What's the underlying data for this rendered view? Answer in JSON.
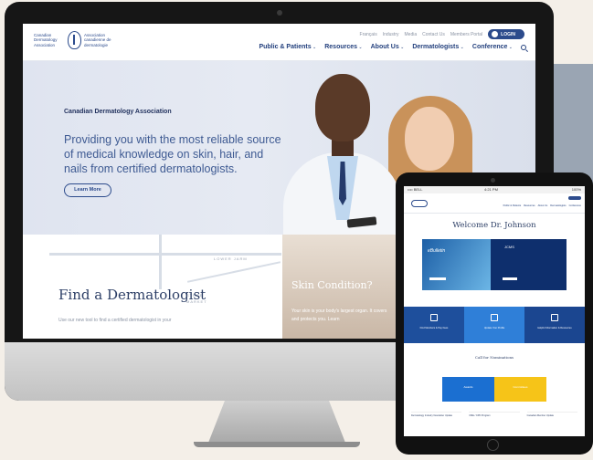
{
  "imac_site": {
    "logo": {
      "en": "Canadian Dermatology Association",
      "fr": "Association canadienne de dermatologie"
    },
    "utility_links": [
      "Français",
      "Industry",
      "Media",
      "Contact Us",
      "Members Portal"
    ],
    "login_label": "LOGIN",
    "nav": [
      "Public & Patients",
      "Resources",
      "About Us",
      "Dermatologists",
      "Conference"
    ],
    "hero": {
      "kicker": "Canadian Dermatology Association",
      "headline": "Providing you with the most reliable source of medical knowledge on skin, hair, and nails from certified dermatologists.",
      "cta": "Learn More"
    },
    "find_card": {
      "map_labels": [
        "LOWER JARM",
        "STREE",
        "MARKET"
      ],
      "title": "Find a Dermatologist",
      "desc": "Use our new tool to find a certified dermatologist in your"
    },
    "skin_card": {
      "title": "Skin Condition?",
      "desc": "Your skin is your body's largest organ. It covers and protects you. Learn"
    }
  },
  "ipad_site": {
    "status": {
      "carrier": "•••• BELL",
      "time": "4:21 PM",
      "battery": "100%"
    },
    "nav": [
      "Public & Patients",
      "Resources",
      "About Us",
      "Dermatologists",
      "Conference"
    ],
    "welcome": "Welcome Dr. Johnson",
    "banner": {
      "script": "eBulletin",
      "journal": "JCMS"
    },
    "tiles": [
      {
        "label": "Find Members & Pay Fees",
        "color": "#1e4f9c"
      },
      {
        "label": "Update Your Profile",
        "color": "#2f7fd8"
      },
      {
        "label": "Helpful Information & Resources",
        "color": "#1b4690"
      }
    ],
    "call_title": "Call for Nominations",
    "boxes": [
      {
        "label": "Awards",
        "color": "#1b6fd1"
      },
      {
        "label": "Committees",
        "color": "#f6c418"
      }
    ],
    "columns": [
      "Dermatology Industry Newsletter Update",
      "CME / CPD Program",
      "Canadian Member Update"
    ]
  }
}
